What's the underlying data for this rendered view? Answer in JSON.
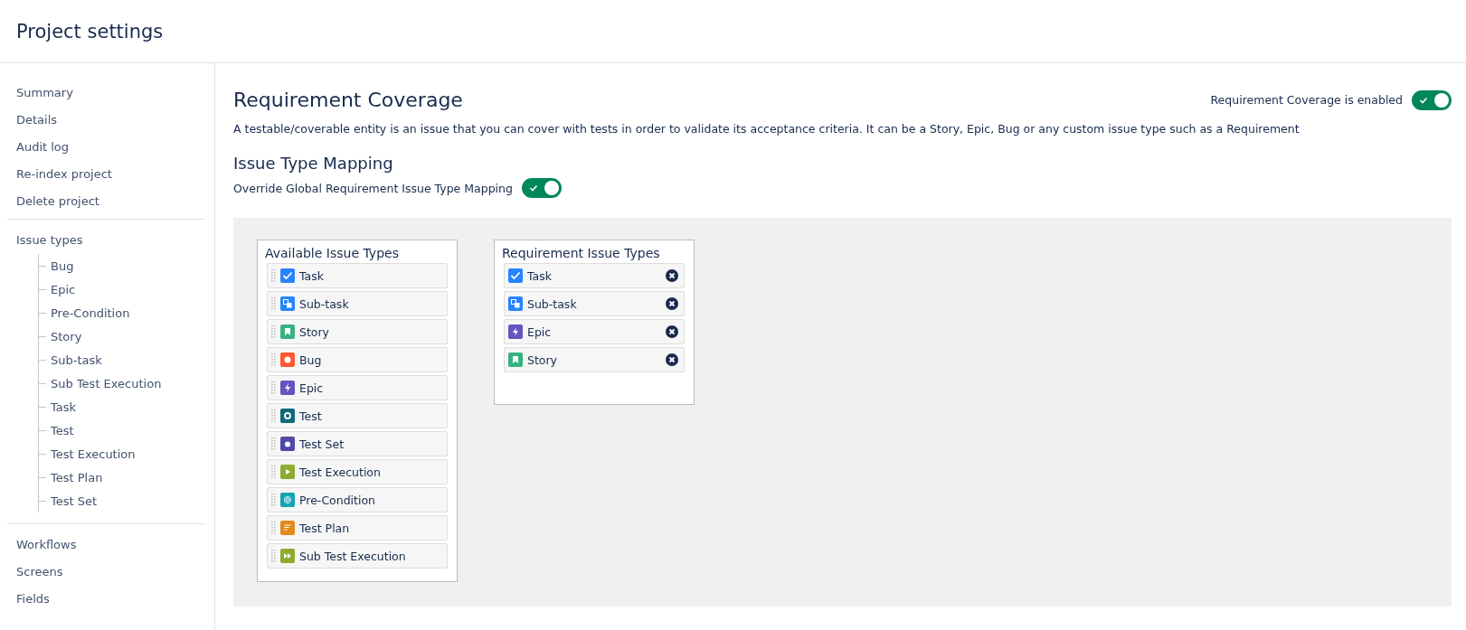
{
  "header": {
    "title": "Project settings"
  },
  "sidebar": {
    "groups": [
      {
        "items": [
          {
            "label": "Summary"
          },
          {
            "label": "Details"
          },
          {
            "label": "Audit log"
          },
          {
            "label": "Re-index project"
          },
          {
            "label": "Delete project"
          }
        ]
      },
      {
        "items": [
          {
            "label": "Issue types",
            "children": [
              {
                "label": "Bug"
              },
              {
                "label": "Epic"
              },
              {
                "label": "Pre-Condition"
              },
              {
                "label": "Story"
              },
              {
                "label": "Sub-task"
              },
              {
                "label": "Sub Test Execution"
              },
              {
                "label": "Task"
              },
              {
                "label": "Test"
              },
              {
                "label": "Test Execution"
              },
              {
                "label": "Test Plan"
              },
              {
                "label": "Test Set"
              }
            ]
          }
        ]
      },
      {
        "items": [
          {
            "label": "Workflows"
          },
          {
            "label": "Screens"
          },
          {
            "label": "Fields"
          }
        ]
      }
    ]
  },
  "coverage": {
    "title": "Requirement Coverage",
    "toggle_label": "Requirement Coverage is enabled",
    "on": true,
    "description": "A testable/coverable entity is an issue that you can cover with tests in order to validate its acceptance criteria. It can be a Story, Epic, Bug or any custom issue type such as a Requirement"
  },
  "mapping": {
    "title": "Issue Type Mapping",
    "toggle_label": "Override Global Requirement Issue Type Mapping",
    "on": true
  },
  "available": {
    "title": "Available Issue Types",
    "items": [
      {
        "label": "Task",
        "kind": "task"
      },
      {
        "label": "Sub-task",
        "kind": "subtask"
      },
      {
        "label": "Story",
        "kind": "story"
      },
      {
        "label": "Bug",
        "kind": "bug"
      },
      {
        "label": "Epic",
        "kind": "epic"
      },
      {
        "label": "Test",
        "kind": "test"
      },
      {
        "label": "Test Set",
        "kind": "testset"
      },
      {
        "label": "Test Execution",
        "kind": "testexec"
      },
      {
        "label": "Pre-Condition",
        "kind": "precondition"
      },
      {
        "label": "Test Plan",
        "kind": "testplan"
      },
      {
        "label": "Sub Test Execution",
        "kind": "subtestexec"
      }
    ]
  },
  "requirement": {
    "title": "Requirement Issue Types",
    "items": [
      {
        "label": "Task",
        "kind": "task"
      },
      {
        "label": "Sub-task",
        "kind": "subtask"
      },
      {
        "label": "Epic",
        "kind": "epic"
      },
      {
        "label": "Story",
        "kind": "story"
      }
    ]
  }
}
